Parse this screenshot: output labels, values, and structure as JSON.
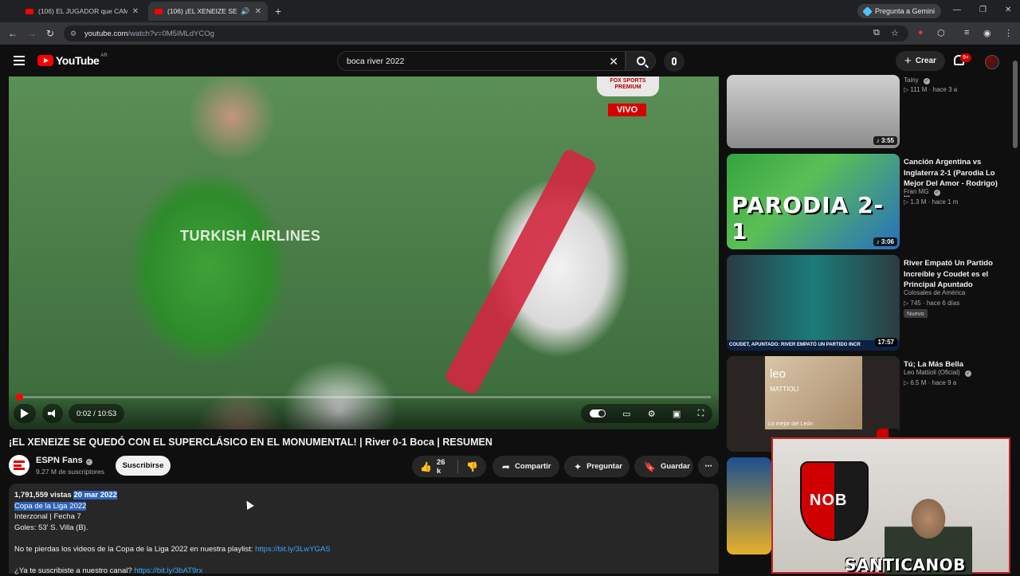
{
  "browser": {
    "tabs": [
      {
        "title": "(106) EL JUGADOR que CAMBIÓ",
        "active": false
      },
      {
        "title": "(106) ¡EL XENEIZE SE QUEDÓ",
        "active": true
      }
    ],
    "gemini_label": "Pregunta a Gemini",
    "url_host": "youtube.com",
    "url_rest": "/watch?v=0M5IMLdYCOg"
  },
  "youtube": {
    "logo_text": "YouTube",
    "country_code": "AR",
    "search_value": "boca river 2022",
    "create_label": "Crear",
    "notif_count": "9+"
  },
  "player": {
    "time": "0:02 / 10:53",
    "progress_fraction": 0.003,
    "overlay_logo": "FOX SPORTS PREMIUM",
    "live_badge": "VIVO",
    "jersey_text": "TURKISH AIRLINES"
  },
  "video": {
    "title": "¡EL XENEIZE SE QUEDÓ CON EL SUPERCLÁSICO EN EL MONUMENTAL! | River 0-1 Boca | RESUMEN",
    "channel": "ESPN Fans",
    "subscribers": "9.27 M de suscriptores",
    "subscribe_label": "Suscribirse",
    "likes": "26 k",
    "share_label": "Compartir",
    "ask_label": "Preguntar",
    "save_label": "Guardar"
  },
  "description": {
    "views": "1,791,559 vistas",
    "date": "20 mar 2022",
    "line1": "Copa de la Liga 2022",
    "line2": "Interzonal | Fecha 7",
    "line3": "Goles: 53' S. Villa (B).",
    "line4_text": "No te pierdas los videos de la Copa de la Liga 2022 en nuestra playlist: ",
    "line4_link": "https://bit.ly/3LwYGAS",
    "line5_text": "¿Ya te suscribiste a nuestro canal? ",
    "line5_link": "https://bit.ly/3bAT9rx"
  },
  "sidebar": [
    {
      "title": "",
      "channel": "Tainy",
      "views": "111 M",
      "age": "hace 3 a",
      "duration": "3:55",
      "badge": ""
    },
    {
      "title": "Canción Argentina vs Inglaterra 2-1 (Parodia Lo Mejor Del Amor - Rodrigo) ...",
      "channel": "Fran MG",
      "views": "1.3 M",
      "age": "hace 1 m",
      "duration": "3:06",
      "badge": "",
      "thumb_text": "PARODIA",
      "thumb_score": "2-1"
    },
    {
      "title": "River Empató Un Partido Increíble y Coudet es el Principal Apuntado",
      "channel": "Colosales de América",
      "views": "745",
      "age": "hace 6 días",
      "duration": "17:57",
      "badge": "Nuevo",
      "thumb_text": "COUDET, APUNTADO: RIVER EMPATÓ UN PARTIDO INCR"
    },
    {
      "title": "Tú; La Más Bella",
      "channel": "Leo Mattioli (Oficial)",
      "views": "6.5 M",
      "age": "hace 9 a",
      "duration": "",
      "badge": "",
      "thumb_text": "leo",
      "thumb_sub": "MATTIOLI",
      "thumb_caption": "Lo mejor del León"
    }
  ],
  "webcam": {
    "crest_text": "NOB",
    "streamer_name": "SANTICANOB"
  }
}
